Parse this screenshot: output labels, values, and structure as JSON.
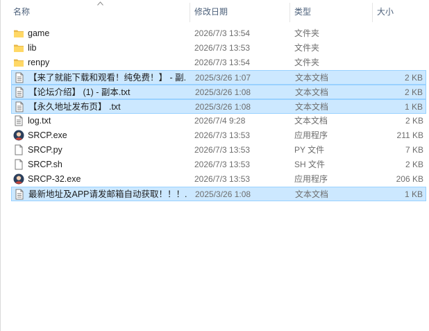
{
  "columns": {
    "name": "名称",
    "date": "修改日期",
    "type": "类型",
    "size": "大小"
  },
  "files": [
    {
      "name": "game",
      "date": "2026/7/3 13:54",
      "type": "文件夹",
      "size": "",
      "icon": "folder-icon",
      "selected": false
    },
    {
      "name": "lib",
      "date": "2026/7/3 13:53",
      "type": "文件夹",
      "size": "",
      "icon": "folder-icon",
      "selected": false
    },
    {
      "name": "renpy",
      "date": "2026/7/3 13:54",
      "type": "文件夹",
      "size": "",
      "icon": "folder-icon",
      "selected": false
    },
    {
      "name": "【来了就能下载和观看！纯免费！】 - 副...",
      "date": "2025/3/26 1:07",
      "type": "文本文档",
      "size": "2 KB",
      "icon": "text-file-icon",
      "selected": true
    },
    {
      "name": "【论坛介绍】 (1) - 副本.txt",
      "date": "2025/3/26 1:08",
      "type": "文本文档",
      "size": "2 KB",
      "icon": "text-file-icon",
      "selected": true
    },
    {
      "name": "【永久地址发布页】 .txt",
      "date": "2025/3/26 1:08",
      "type": "文本文档",
      "size": "1 KB",
      "icon": "text-file-icon",
      "selected": true
    },
    {
      "name": "log.txt",
      "date": "2026/7/4 9:28",
      "type": "文本文档",
      "size": "2 KB",
      "icon": "text-file-icon",
      "selected": false
    },
    {
      "name": "SRCP.exe",
      "date": "2026/7/3 13:53",
      "type": "应用程序",
      "size": "211 KB",
      "icon": "app-icon",
      "selected": false
    },
    {
      "name": "SRCP.py",
      "date": "2026/7/3 13:53",
      "type": "PY 文件",
      "size": "7 KB",
      "icon": "file-icon",
      "selected": false
    },
    {
      "name": "SRCP.sh",
      "date": "2026/7/3 13:53",
      "type": "SH 文件",
      "size": "2 KB",
      "icon": "file-icon",
      "selected": false
    },
    {
      "name": "SRCP-32.exe",
      "date": "2026/7/3 13:53",
      "type": "应用程序",
      "size": "206 KB",
      "icon": "app-icon",
      "selected": false
    },
    {
      "name": "最新地址及APP请发邮箱自动获取！！！...",
      "date": "2025/3/26 1:08",
      "type": "文本文档",
      "size": "1 KB",
      "icon": "text-file-icon",
      "selected": true
    }
  ]
}
